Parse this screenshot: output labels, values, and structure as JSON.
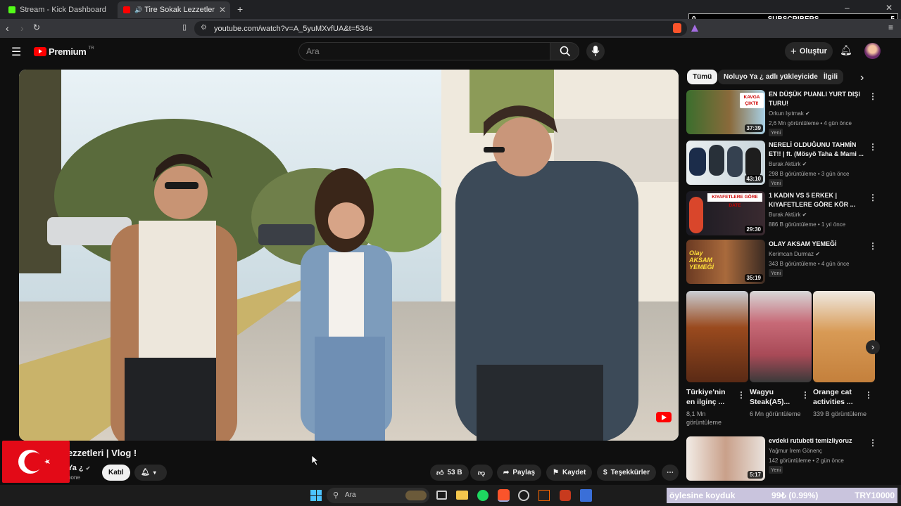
{
  "browser": {
    "tabs": [
      {
        "title": "Stream - Kick Dashboard",
        "active": false
      },
      {
        "title": "Tire Sokak Lezzetleri | Vlog !",
        "active": true
      }
    ],
    "new_tab": "+",
    "url": "youtube.com/watch?v=A_5yuMXvfUA&t=534s"
  },
  "overlay": {
    "subs_left": "0",
    "subs_label": "SUBSCRIBERS",
    "subs_right": "5"
  },
  "header": {
    "logo": "Premium",
    "logo_sup": "TR",
    "search_placeholder": "Ara",
    "create_label": "Oluştur"
  },
  "chips": [
    "Tümü",
    "Noluyo Ya ¿ adlı yükleyiciden",
    "İlgili"
  ],
  "video": {
    "title": "Lezzetleri | Vlog !",
    "channel_fragment": "Ya ¿",
    "subs_fragment": "bone",
    "join_label": "Katıl",
    "like_count": "53 B",
    "share_label": "Paylaş",
    "save_label": "Kaydet",
    "thanks_label": "Teşekkürler"
  },
  "recommendations": [
    {
      "title": "EN DÜŞÜK PUANLI YURT DIŞI TURU!",
      "channel": "Orkun Işıtmak",
      "meta": "2,6 Mn görüntüleme • 4 gün önce",
      "badge": "Yeni",
      "duration": "37:39",
      "thumb_text": "KAVGA ÇIKTI!"
    },
    {
      "title": "NERELİ OLDUĞUNU TAHMİN ET!! | ft. (Mösyö Taha & Mami ...",
      "channel": "Burak Aktürk",
      "meta": "298 B görüntüleme • 3 gün önce",
      "badge": "Yeni",
      "duration": "43:10",
      "thumb_text": ""
    },
    {
      "title": "1 KADIN VS 5 ERKEK | KIYAFETLERE GÖRE KÖR ...",
      "channel": "Burak Aktürk",
      "meta": "886 B görüntüleme • 1 yıl önce",
      "badge": "",
      "duration": "29:30",
      "thumb_text": "KIYAFETLERE GÖRE DATE"
    },
    {
      "title": "OLAY AKSAM YEMEĞİ",
      "channel": "Kerimcan Durmaz",
      "meta": "343 B görüntüleme • 4 gün önce",
      "badge": "Yeni",
      "duration": "35:19",
      "thumb_text": "Olay AKSAM YEMEĞİ"
    },
    {
      "title": "evdeki rutubeti temizliyoruz",
      "channel": "Yağmur İrem Gönenç",
      "meta": "142 görüntüleme • 2 gün önce",
      "badge": "Yeni",
      "duration": "5:17",
      "thumb_text": ""
    }
  ],
  "shorts": [
    {
      "title": "Türkiye'nin en ilginç ...",
      "views": "8,1 Mn görüntüleme"
    },
    {
      "title": "Wagyu Steak(A5)...",
      "views": "6 Mn görüntüleme"
    },
    {
      "title": "Orange cat activities ...",
      "views": "339 B görüntüleme"
    }
  ],
  "taskbar": {
    "search_placeholder": "Ara"
  },
  "ticker": {
    "text": "öylesine koyduk",
    "value": "99₺ (0.99%)",
    "total": "TRY10000"
  },
  "colors": {
    "youtube_red": "#ff0000",
    "bg": "#0f0f0f",
    "chip_bg": "#272727"
  }
}
